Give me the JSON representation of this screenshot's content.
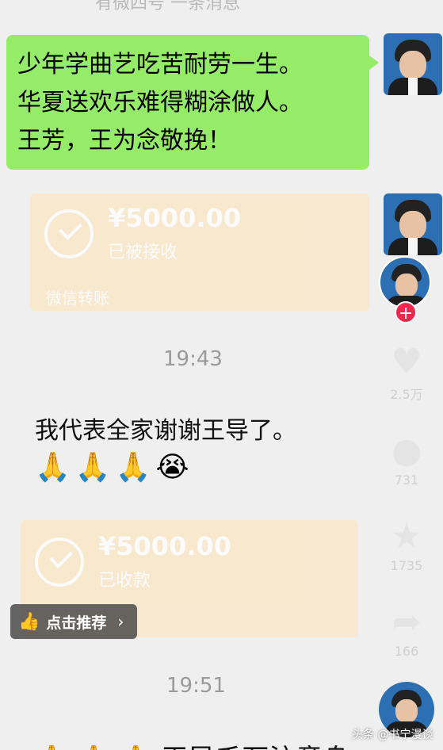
{
  "header_cut_text": "有微四号 一条消息",
  "green_message": {
    "lines": [
      "少年学曲艺吃苦耐劳一生。",
      "华夏送欢乐难得糊涂做人。",
      "王芳，王为念敬挽！"
    ]
  },
  "transfer_1": {
    "amount": "¥5000.00",
    "status": "已被接收",
    "footer": "微信转账"
  },
  "time_1": "19:43",
  "white_message": {
    "text": "我代表全家谢谢王导了。",
    "emojis": [
      "🙏",
      "🙏",
      "🙏",
      "😭"
    ]
  },
  "transfer_2": {
    "amount": "¥5000.00",
    "status": "已收款"
  },
  "time_2": "19:51",
  "side_actions": {
    "like_count": "2.5万",
    "comment_count": "731",
    "favorite_count": "1735",
    "share_count": "166",
    "follow_label": "+"
  },
  "recommend_button": {
    "label": "点击推荐",
    "chevron": "›"
  },
  "watermark": "头条 @书宁漫谈",
  "bottom_cut_text": "🙏 🙏 🙏 王导千万注意身"
}
